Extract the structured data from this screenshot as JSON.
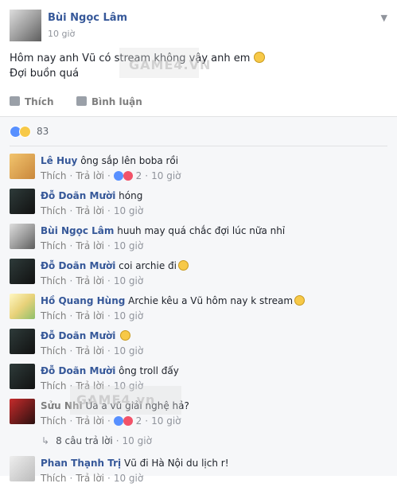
{
  "post": {
    "author": "Bùi Ngọc Lâm",
    "time": "10 giờ",
    "text_line1": "Hôm nay anh Vũ có stream không vậy anh em",
    "text_line2": "Đợi buồn quá",
    "watermark": "GAME4.VN"
  },
  "actions": {
    "like_label": "Thích",
    "comment_label": "Bình luận"
  },
  "reactions": {
    "count": "83"
  },
  "comments": [
    {
      "name": "Lê Huy",
      "text": "ông sắp lên boba rồi",
      "like": "Thích",
      "reply": "Trả lời",
      "reaction_count": "2",
      "time": "10 giờ"
    },
    {
      "name": "Đỗ Doãn Mười",
      "text": "hóng",
      "like": "Thích",
      "reply": "Trả lời",
      "time": "10 giờ"
    },
    {
      "name": "Bùi Ngọc Lâm",
      "text": "huuh may quá chắc đợi lúc nữa nhỉ",
      "like": "Thích",
      "reply": "Trả lời",
      "time": "10 giờ"
    },
    {
      "name": "Đỗ Doãn Mười",
      "text": "coi archie đi",
      "like": "Thích",
      "reply": "Trả lời",
      "time": "10 giờ"
    },
    {
      "name": "Hồ Quang Hùng",
      "text": "Archie kêu a Vũ hôm nay k stream",
      "like": "Thích",
      "reply": "Trả lời",
      "time": "10 giờ"
    },
    {
      "name": "Đỗ Doãn Mười",
      "text": "",
      "like": "Thích",
      "reply": "Trả lời",
      "time": "10 giờ"
    },
    {
      "name": "Đỗ Doãn Mười",
      "text": "ông troll đấy",
      "like": "Thích",
      "reply": "Trả lời",
      "time": "10 giờ"
    },
    {
      "name": "Sửu Nhi",
      "text": "Ủa a vũ giải nghệ hả?",
      "like": "Thích",
      "reply": "Trả lời",
      "reaction_count": "2",
      "time": "10 giờ"
    },
    {
      "name": "Phan Thạnh Trị",
      "text": "Vũ đi Hà Nội du lịch r!",
      "like": "Thích",
      "reply": "Trả lời",
      "time": "10 giờ"
    }
  ],
  "replies_link": "8 câu trả lời",
  "replies_time": "10 giờ",
  "watermark2": "GAME4.vn",
  "colors": {
    "name_blue": "#365899",
    "meta_grey": "#90949c",
    "panel_bg": "#f6f7f9"
  }
}
